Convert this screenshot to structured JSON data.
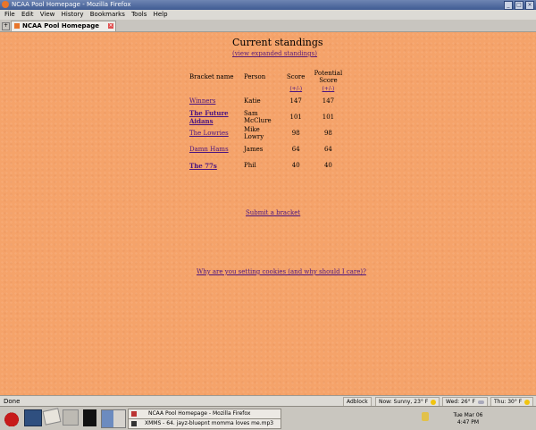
{
  "window": {
    "title": "NCAA Pool Homepage - Mozilla Firefox"
  },
  "menu": [
    "File",
    "Edit",
    "View",
    "History",
    "Bookmarks",
    "Tools",
    "Help"
  ],
  "tab": {
    "label": "NCAA Pool Homepage"
  },
  "page": {
    "title": "Current standings",
    "view_link": "(view expanded standings)",
    "headers": {
      "bracket": "Bracket name",
      "person": "Person",
      "score": "Score",
      "potential": "Potential Score"
    },
    "sort_labels": {
      "score": "(+/-)",
      "potential": "(+/-)"
    },
    "rows": [
      {
        "bracket": "Winners",
        "person": "Katie",
        "score": "147",
        "potential": "147"
      },
      {
        "bracket": "The Future Aidans",
        "person": "Sam McClure",
        "score": "101",
        "potential": "101"
      },
      {
        "bracket": "The Lowries",
        "person": "Mike Lowry",
        "score": "98",
        "potential": "98"
      },
      {
        "bracket": "Damn Hams",
        "person": "James",
        "score": "64",
        "potential": "64"
      },
      {
        "bracket": "The 77s",
        "person": "Phil",
        "score": "40",
        "potential": "40"
      }
    ],
    "submit_link": "Submit a bracket",
    "cookies_link": "Why are you setting cookies (and why should I care)?"
  },
  "status": {
    "text": "Done",
    "adblock": "Adblock",
    "weather_now": "Now: Sunny, 23° F",
    "weather_wed": "Wed: 26° F",
    "weather_thu": "Thu: 30° F"
  },
  "taskbar": {
    "tasks": [
      "NCAA Pool Homepage - Mozilla Firefox",
      "XMMS - 64. jayz-bluepnt momma loves me.mp3"
    ],
    "date": "Tue Mar 06",
    "time": "4:47 PM"
  },
  "colors": {
    "page_bg": "#f5a36a",
    "link": "#4a1480"
  }
}
